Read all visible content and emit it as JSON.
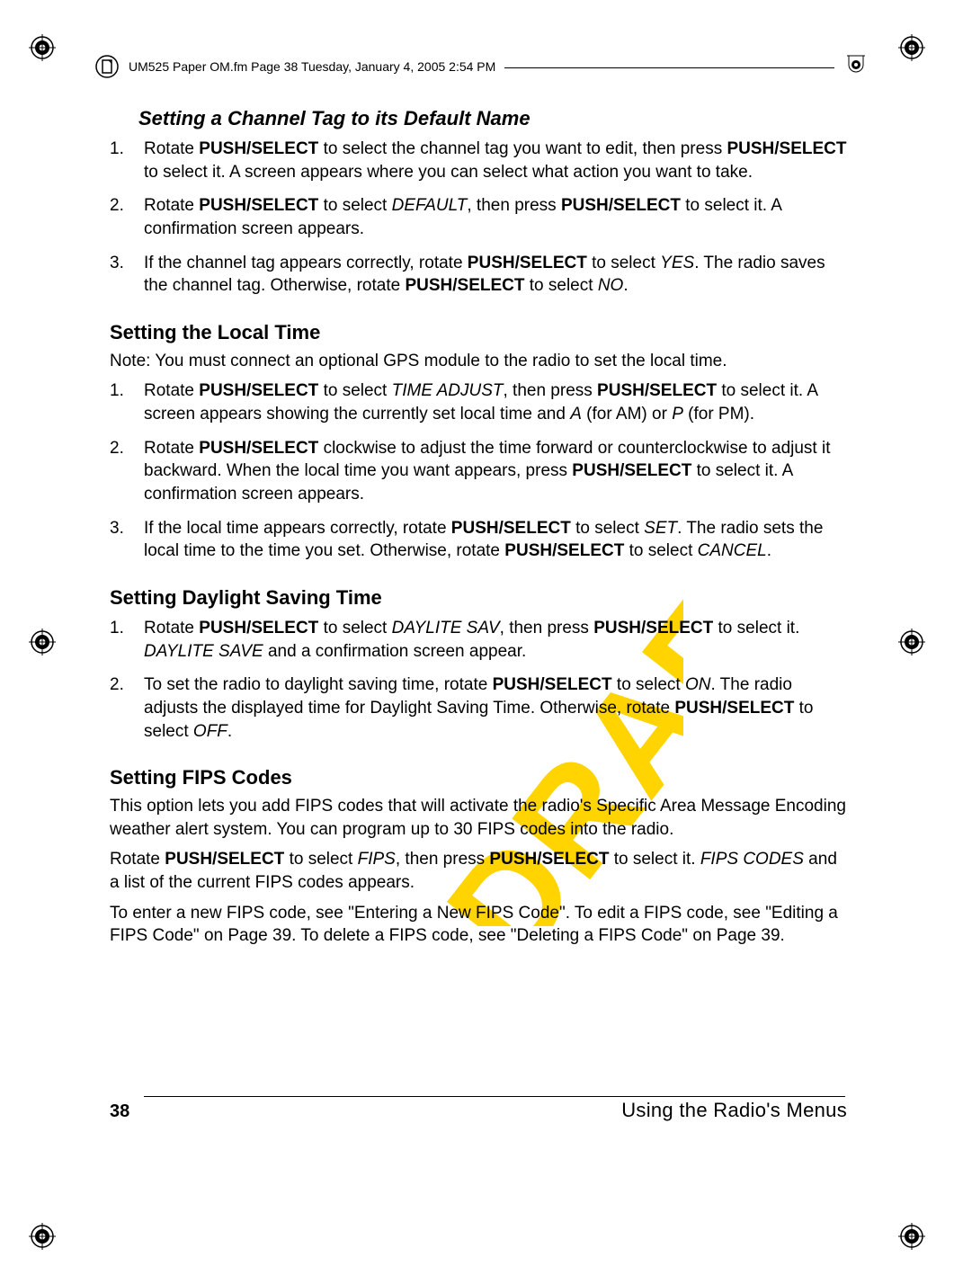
{
  "header": {
    "text": "UM525 Paper OM.fm  Page 38  Tuesday, January 4, 2005  2:54 PM"
  },
  "watermark": "DRAFT",
  "section1": {
    "title": "Setting a Channel Tag to its Default Name",
    "items": [
      {
        "num": "1.",
        "parts": [
          {
            "t": "Rotate "
          },
          {
            "t": "PUSH/SELECT",
            "b": true
          },
          {
            "t": " to select the channel tag you want to edit, then press "
          },
          {
            "t": "PUSH/SELECT",
            "b": true
          },
          {
            "t": " to select it. A screen appears where you can select what action you want to take."
          }
        ]
      },
      {
        "num": "2.",
        "parts": [
          {
            "t": "Rotate "
          },
          {
            "t": "PUSH/SELECT",
            "b": true
          },
          {
            "t": " to select "
          },
          {
            "t": "DEFAULT",
            "i": true
          },
          {
            "t": ", then press "
          },
          {
            "t": "PUSH/SELECT",
            "b": true
          },
          {
            "t": " to select it. A confirmation screen appears."
          }
        ]
      },
      {
        "num": "3.",
        "parts": [
          {
            "t": "If the channel tag appears correctly, rotate "
          },
          {
            "t": "PUSH/SELECT",
            "b": true
          },
          {
            "t": " to select "
          },
          {
            "t": "YES",
            "i": true
          },
          {
            "t": ". The radio saves the channel tag. Otherwise, rotate "
          },
          {
            "t": "PUSH/SELECT",
            "b": true
          },
          {
            "t": " to select "
          },
          {
            "t": "NO",
            "i": true
          },
          {
            "t": "."
          }
        ]
      }
    ]
  },
  "section2": {
    "title": "Setting the Local Time",
    "note": "Note: You must connect an optional GPS module to the radio to set the local time.",
    "items": [
      {
        "num": "1.",
        "parts": [
          {
            "t": "Rotate "
          },
          {
            "t": "PUSH/SELECT",
            "b": true
          },
          {
            "t": " to select "
          },
          {
            "t": "TIME ADJUST",
            "i": true
          },
          {
            "t": ", then press "
          },
          {
            "t": "PUSH/SELECT",
            "b": true
          },
          {
            "t": " to select it. A screen appears showing the currently set local time and "
          },
          {
            "t": "A",
            "i": true
          },
          {
            "t": " (for AM) or "
          },
          {
            "t": "P",
            "i": true
          },
          {
            "t": " (for PM)."
          }
        ]
      },
      {
        "num": "2.",
        "parts": [
          {
            "t": "Rotate "
          },
          {
            "t": "PUSH/SELECT",
            "b": true
          },
          {
            "t": " clockwise to adjust the time forward or counterclockwise to adjust it backward. When the local time you want appears, press "
          },
          {
            "t": "PUSH/SELECT",
            "b": true
          },
          {
            "t": " to select it. A confirmation screen appears."
          }
        ]
      },
      {
        "num": "3.",
        "parts": [
          {
            "t": "If the local time appears correctly, rotate "
          },
          {
            "t": "PUSH/SELECT",
            "b": true
          },
          {
            "t": " to select "
          },
          {
            "t": "SET",
            "i": true
          },
          {
            "t": ". The radio sets the local time to the time you set. Otherwise, rotate "
          },
          {
            "t": "PUSH/SELECT",
            "b": true
          },
          {
            "t": " to select "
          },
          {
            "t": "CANCEL",
            "i": true
          },
          {
            "t": "."
          }
        ]
      }
    ]
  },
  "section3": {
    "title": "Setting Daylight Saving Time",
    "items": [
      {
        "num": "1.",
        "parts": [
          {
            "t": "Rotate "
          },
          {
            "t": "PUSH/SELECT",
            "b": true
          },
          {
            "t": " to select "
          },
          {
            "t": "DAYLITE SAV",
            "i": true
          },
          {
            "t": ", then press "
          },
          {
            "t": "PUSH/SELECT",
            "b": true
          },
          {
            "t": " to select it. "
          },
          {
            "t": "DAYLITE SAVE",
            "i": true
          },
          {
            "t": " and a confirmation screen appear."
          }
        ]
      },
      {
        "num": "2.",
        "parts": [
          {
            "t": "To set the radio to daylight saving time, rotate "
          },
          {
            "t": "PUSH/SELECT",
            "b": true
          },
          {
            "t": " to select "
          },
          {
            "t": "ON",
            "i": true
          },
          {
            "t": ". The radio adjusts the displayed time for Daylight Saving Time. Otherwise, rotate "
          },
          {
            "t": "PUSH/SELECT",
            "b": true
          },
          {
            "t": " to select "
          },
          {
            "t": "OFF",
            "i": true
          },
          {
            "t": "."
          }
        ]
      }
    ]
  },
  "section4": {
    "title": "Setting FIPS Codes",
    "para1": "This option lets you add FIPS codes that will activate the radio's Specific Area Message Encoding weather alert system. You can program up to 30 FIPS codes into the radio.",
    "para2_parts": [
      {
        "t": "Rotate "
      },
      {
        "t": "PUSH/SELECT",
        "b": true
      },
      {
        "t": " to select "
      },
      {
        "t": "FIPS",
        "i": true
      },
      {
        "t": ", then press "
      },
      {
        "t": "PUSH/SELECT",
        "b": true
      },
      {
        "t": " to select it. "
      },
      {
        "t": "FIPS CODES",
        "i": true
      },
      {
        "t": " and a list of the current FIPS codes appears."
      }
    ],
    "para3": "To enter a new FIPS code, see \"Entering a New FIPS Code\". To edit a FIPS code, see \"Editing a FIPS Code\" on Page 39. To delete a FIPS code, see \"Deleting a FIPS Code\" on Page 39."
  },
  "footer": {
    "pagenum": "38",
    "title": "Using the Radio's Menus"
  }
}
